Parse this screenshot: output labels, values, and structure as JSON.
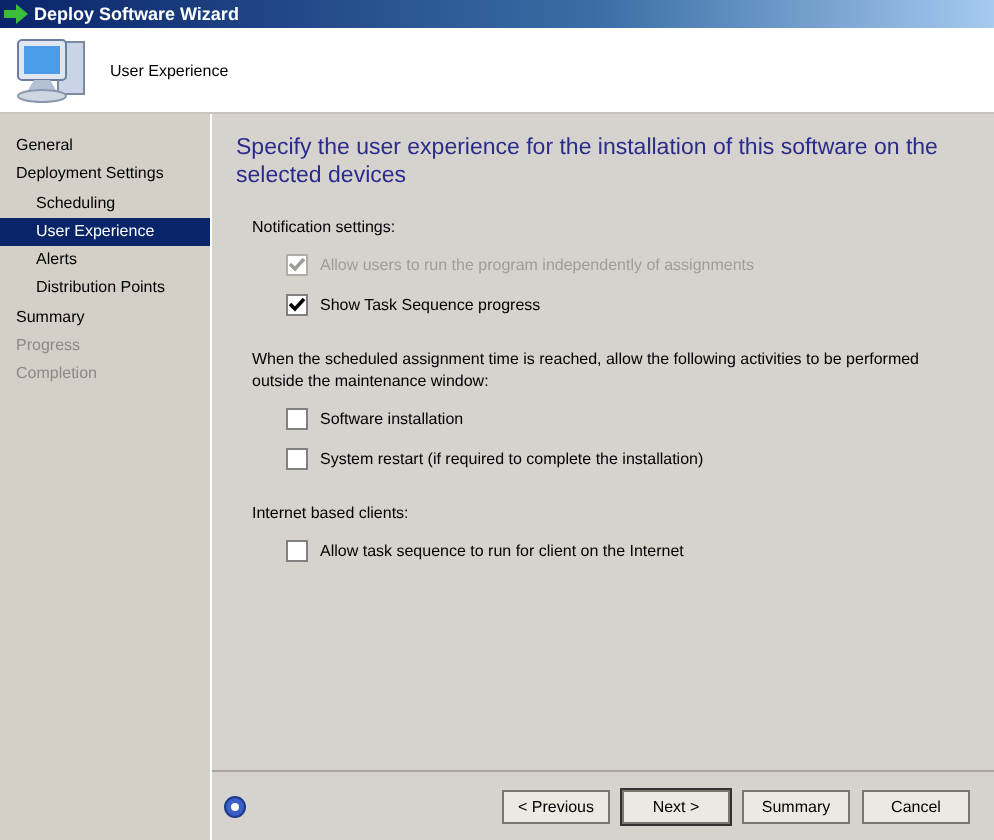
{
  "window": {
    "title": "Deploy Software Wizard"
  },
  "header": {
    "title": "User Experience"
  },
  "sidebar": {
    "items": [
      {
        "label": "General",
        "selected": false,
        "disabled": false
      },
      {
        "label": "Deployment Settings",
        "selected": false,
        "disabled": false,
        "children": [
          {
            "label": "Scheduling",
            "selected": false,
            "disabled": false
          },
          {
            "label": "User Experience",
            "selected": true,
            "disabled": false
          },
          {
            "label": "Alerts",
            "selected": false,
            "disabled": false
          },
          {
            "label": "Distribution Points",
            "selected": false,
            "disabled": false
          }
        ]
      },
      {
        "label": "Summary",
        "selected": false,
        "disabled": false
      },
      {
        "label": "Progress",
        "selected": false,
        "disabled": true
      },
      {
        "label": "Completion",
        "selected": false,
        "disabled": true
      }
    ]
  },
  "content": {
    "heading": "Specify the user experience for the installation of this software on the selected devices",
    "sections": [
      {
        "label": "Notification settings:",
        "options": [
          {
            "label": "Allow users to run the program independently of assignments",
            "checked": true,
            "disabled": true
          },
          {
            "label": "Show Task Sequence progress",
            "checked": true,
            "disabled": false
          }
        ]
      },
      {
        "label": "When the scheduled assignment time is reached, allow the following activities to be performed outside the maintenance window:",
        "options": [
          {
            "label": "Software installation",
            "checked": false,
            "disabled": false
          },
          {
            "label": "System restart (if required to complete the installation)",
            "checked": false,
            "disabled": false
          }
        ]
      },
      {
        "label": "Internet based clients:",
        "options": [
          {
            "label": "Allow task sequence to run for client on the Internet",
            "checked": false,
            "disabled": false
          }
        ]
      }
    ]
  },
  "buttons": [
    "< Previous",
    "Next >",
    "Summary",
    "Cancel"
  ]
}
